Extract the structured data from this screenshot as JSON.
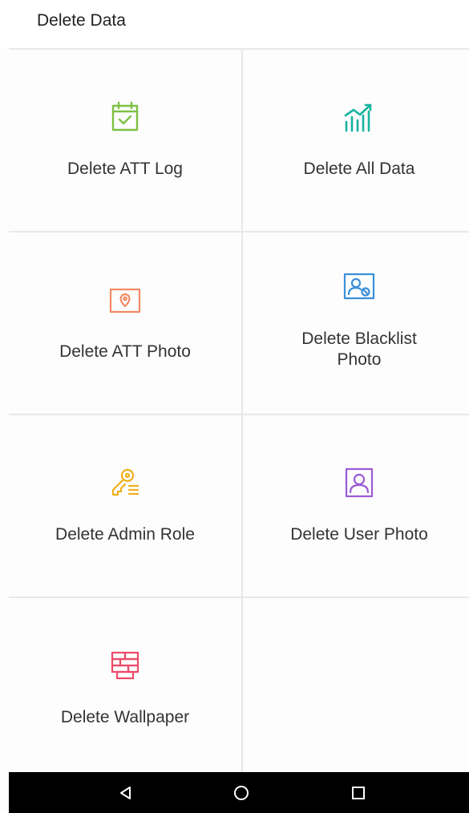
{
  "header": {
    "title": "Delete Data"
  },
  "items": [
    {
      "label": "Delete ATT Log",
      "icon": "calendar-check-icon",
      "color": "#7dc142"
    },
    {
      "label": "Delete All Data",
      "icon": "bar-chart-trend-icon",
      "color": "#16b39e"
    },
    {
      "label": "Delete ATT Photo",
      "icon": "photo-location-icon",
      "color": "#f28a63"
    },
    {
      "label": "Delete Blacklist Photo",
      "icon": "blacklist-photo-icon",
      "color": "#3b8fd9"
    },
    {
      "label": "Delete Admin Role",
      "icon": "key-list-icon",
      "color": "#f0b01c"
    },
    {
      "label": "Delete User Photo",
      "icon": "user-photo-icon",
      "color": "#9a5bd6"
    },
    {
      "label": "Delete Wallpaper",
      "icon": "wallpaper-bricks-icon",
      "color": "#ee4b6a"
    }
  ],
  "navbar": {
    "back_icon": "back-triangle-icon",
    "home_icon": "home-circle-icon",
    "recents_icon": "recents-square-icon"
  }
}
